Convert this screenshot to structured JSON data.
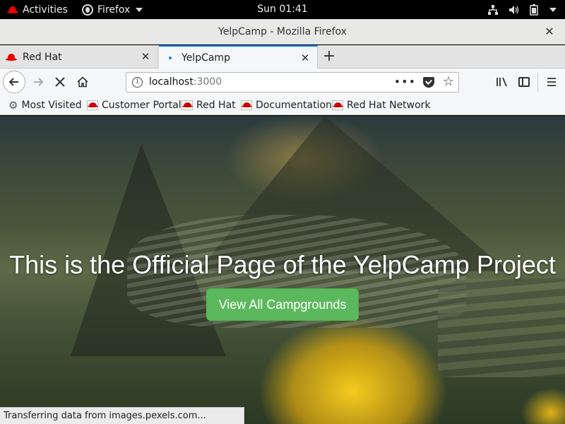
{
  "topbar": {
    "activities": "Activities",
    "app_name": "Firefox",
    "clock": "Sun 01:41"
  },
  "window": {
    "title": "YelpCamp - Mozilla Firefox"
  },
  "tabs": [
    {
      "label": "Red Hat",
      "icon": "redhat-icon",
      "active": false
    },
    {
      "label": "YelpCamp",
      "icon": "loading-icon",
      "active": true
    }
  ],
  "navbar": {
    "url_host": "localhost",
    "url_port": ":3000"
  },
  "bookmarks": [
    {
      "label": "Most Visited",
      "icon": "gear-icon"
    },
    {
      "label": "Customer Portal",
      "icon": "redhat-icon"
    },
    {
      "label": "Red Hat",
      "icon": "redhat-icon"
    },
    {
      "label": "Documentation",
      "icon": "redhat-icon"
    },
    {
      "label": "Red Hat Network",
      "icon": "redhat-icon"
    }
  ],
  "page": {
    "heading": "This is the Official Page of the YelpCamp Project",
    "button_label": "View All Campgrounds",
    "button_color": "#5cb85c"
  },
  "status": "Transferring data from images.pexels.com..."
}
